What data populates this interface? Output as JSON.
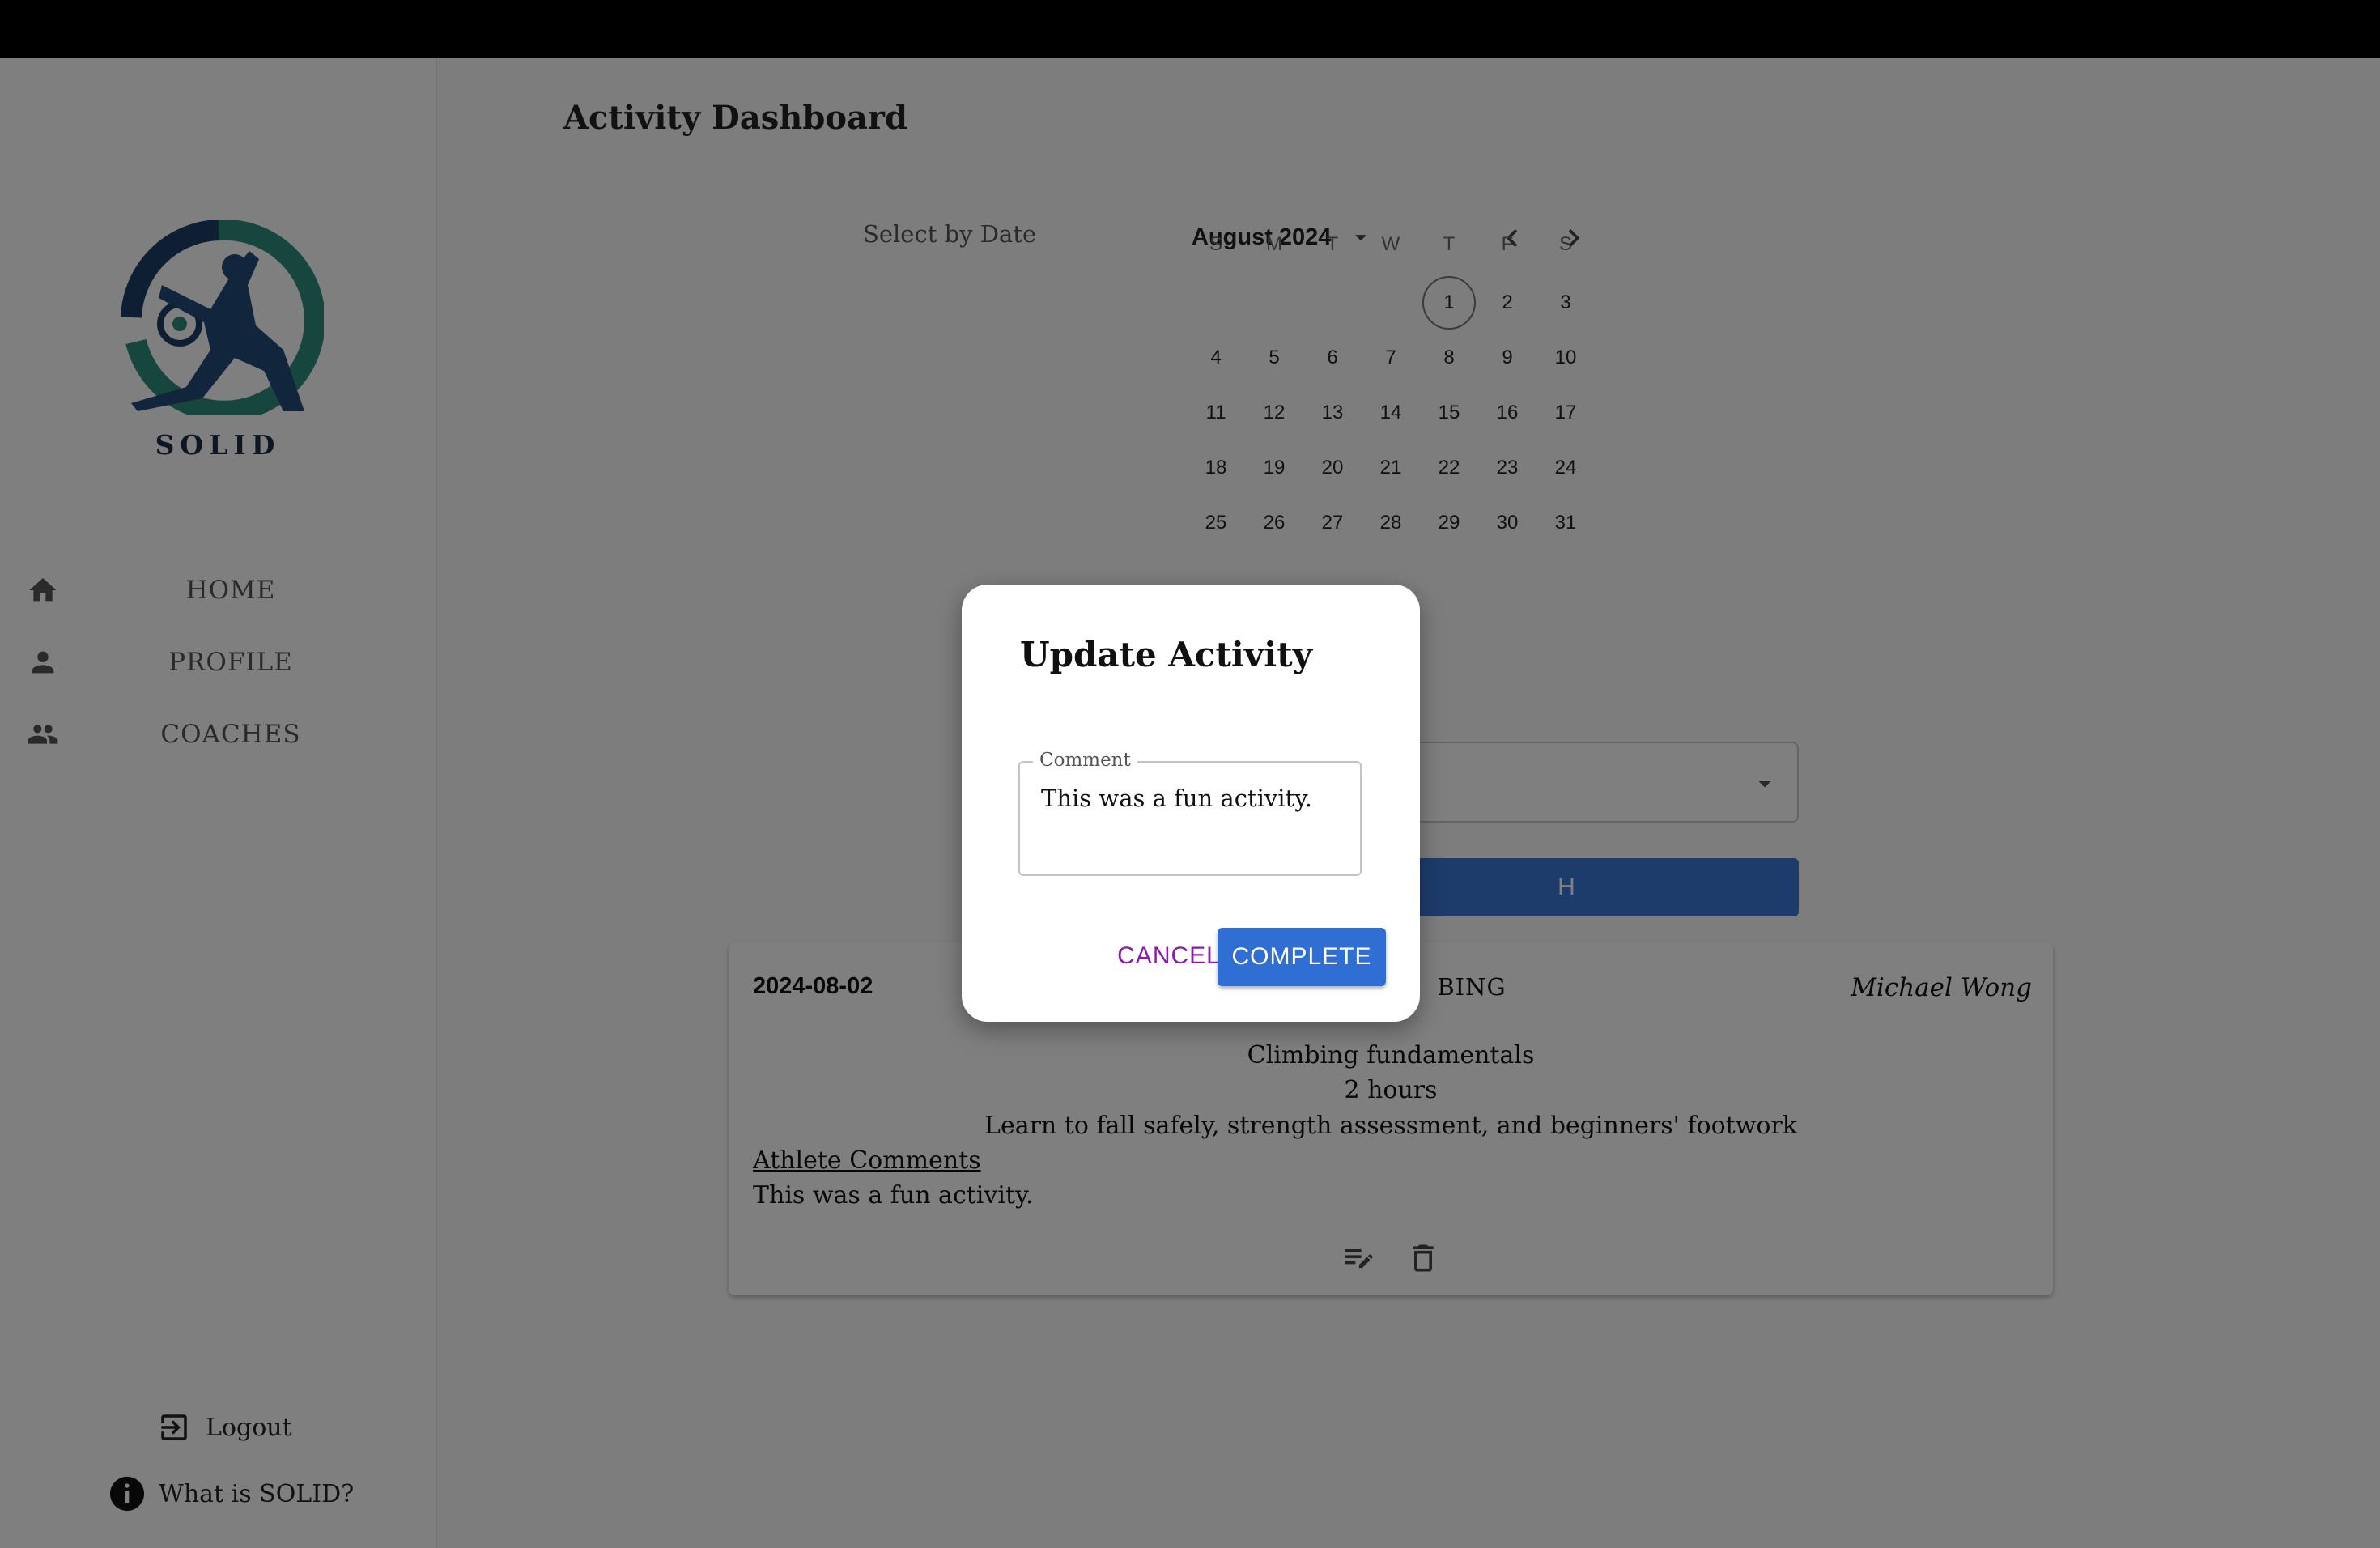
{
  "brand": {
    "name": "SOLID"
  },
  "sidebar": {
    "items": [
      {
        "label": "HOME",
        "icon": "home-icon"
      },
      {
        "label": "PROFILE",
        "icon": "person-icon"
      },
      {
        "label": "COACHES",
        "icon": "group-icon"
      }
    ],
    "logout_label": "Logout",
    "about_label": "What is SOLID?"
  },
  "main": {
    "title": "Activity Dashboard",
    "select_by_date": "Select by Date",
    "search_label": "H"
  },
  "calendar": {
    "month_label": "August 2024",
    "weekdays": [
      "S",
      "M",
      "T",
      "W",
      "T",
      "F",
      "S"
    ],
    "days": [
      "1",
      "2",
      "3",
      "4",
      "5",
      "6",
      "7",
      "8",
      "9",
      "10",
      "11",
      "12",
      "13",
      "14",
      "15",
      "16",
      "17",
      "18",
      "19",
      "20",
      "21",
      "22",
      "23",
      "24",
      "25",
      "26",
      "27",
      "28",
      "29",
      "30",
      "31"
    ],
    "first_weekday_index": 4,
    "today": "1"
  },
  "activity": {
    "date": "2024-08-02",
    "type": "BING",
    "coach": "Michael Wong",
    "title": "Climbing fundamentals",
    "duration": "2 hours",
    "description": "Learn to fall safely, strength assessment, and beginners' footwork",
    "comments_label": "Athlete Comments",
    "comment": "This was a fun activity."
  },
  "dialog": {
    "title": "Update Activity",
    "field_label": "Comment",
    "field_value": "This was a fun activity.",
    "cancel_label": "CANCEL",
    "complete_label": "COMPLETE"
  },
  "colors": {
    "primary": "#2f6fd3",
    "cancel_text": "#8b1aa8",
    "overlay": "rgba(0,0,0,0.5)",
    "brand_navy": "#1c2b46"
  }
}
